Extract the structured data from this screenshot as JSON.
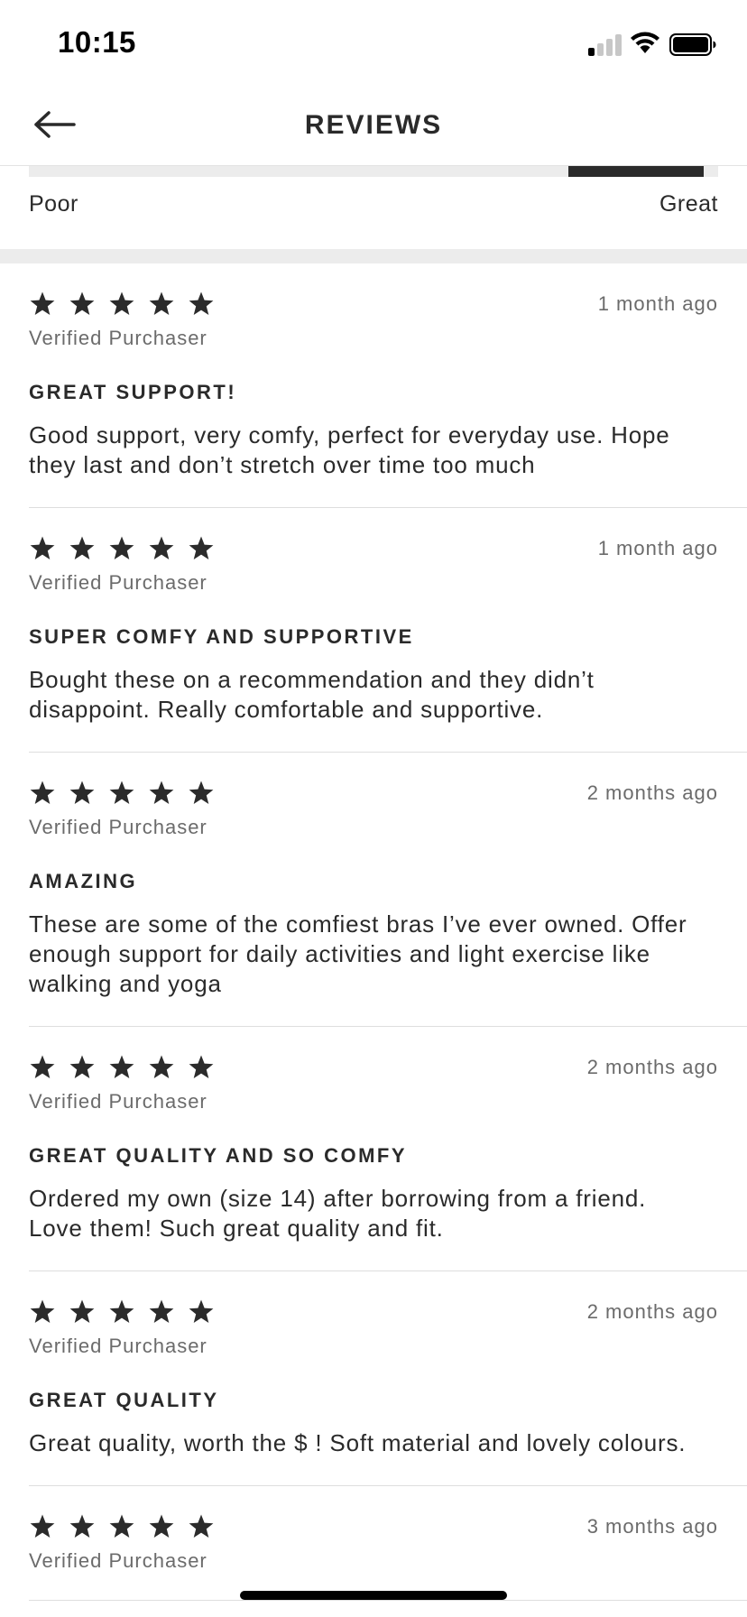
{
  "status_bar": {
    "time": "10:15"
  },
  "header": {
    "title": "REVIEWS"
  },
  "rating_scale": {
    "left_label": "Poor",
    "right_label": "Great",
    "level": 0.95
  },
  "reviews": [
    {
      "rating": 5,
      "date": "1 month ago",
      "verified": "Verified Purchaser",
      "title": "GREAT SUPPORT!",
      "body": "Good support, very comfy, perfect for everyday use. Hope they last and don’t stretch over time too much"
    },
    {
      "rating": 5,
      "date": "1 month ago",
      "verified": "Verified Purchaser",
      "title": "SUPER COMFY AND SUPPORTIVE",
      "body": "Bought these on a recommendation and they didn’t disappoint. Really comfortable and supportive."
    },
    {
      "rating": 5,
      "date": "2 months ago",
      "verified": "Verified Purchaser",
      "title": "AMAZING",
      "body": "These are some of the comfiest bras I’ve ever owned. Offer enough support for daily activities and light exercise like walking and yoga"
    },
    {
      "rating": 5,
      "date": "2 months ago",
      "verified": "Verified Purchaser",
      "title": "GREAT QUALITY AND SO COMFY",
      "body": "Ordered my own (size 14) after borrowing from a friend. Love them! Such great quality and fit."
    },
    {
      "rating": 5,
      "date": "2 months ago",
      "verified": "Verified Purchaser",
      "title": "GREAT QUALITY",
      "body": "Great quality, worth the $ ! Soft material and lovely colours."
    },
    {
      "rating": 5,
      "date": "3 months ago",
      "verified": "Verified Purchaser",
      "title": "",
      "body": ""
    }
  ],
  "colors": {
    "star": "#2b2b2b",
    "muted_text": "#6b6b6b",
    "divider": "#ececec"
  },
  "icons": {
    "back": "arrow-left-icon",
    "star": "star-icon",
    "signal": "cellular-signal-icon",
    "wifi": "wifi-icon",
    "battery": "battery-icon"
  }
}
